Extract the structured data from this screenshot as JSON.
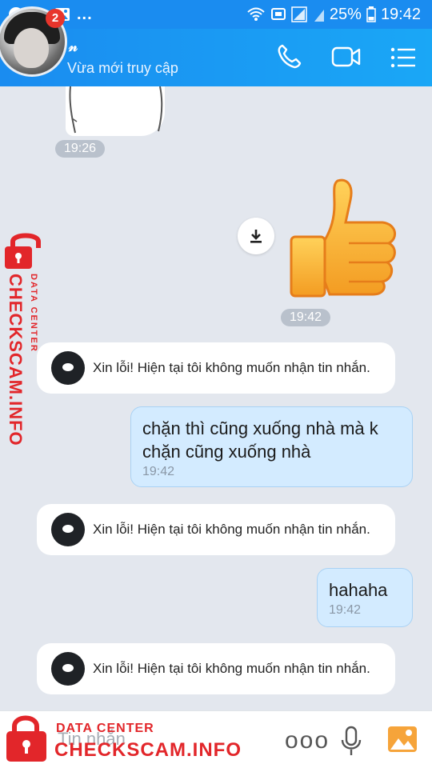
{
  "status_bar": {
    "notification_icons": [
      "messenger-icon",
      "person-add-icon",
      "image-icon"
    ],
    "more_indicator": "...",
    "battery_percent": "25%",
    "time": "19:42"
  },
  "header": {
    "badge_count": "2",
    "contact_name": "𝓃",
    "contact_status": "Vừa mới truy cập",
    "actions": [
      "phone-icon",
      "video-call-icon",
      "menu-icon"
    ]
  },
  "messages": [
    {
      "type": "sticker",
      "sender": "contact",
      "time": "19:26"
    },
    {
      "type": "sticker",
      "sender": "me",
      "sticker": "thumbs-up",
      "time": "19:42"
    },
    {
      "type": "system",
      "text": "Xin lỗi! Hiện tại tôi không muốn nhận tin nhắn."
    },
    {
      "type": "text",
      "sender": "me",
      "line1": "chặn thì cũng xuống nhà mà k",
      "line2": "chặn cũng xuống nhà",
      "time": "19:42"
    },
    {
      "type": "system",
      "text": "Xin lỗi! Hiện tại tôi không muốn nhận tin nhắn."
    },
    {
      "type": "text",
      "sender": "me",
      "text": "hahaha",
      "time": "19:42"
    },
    {
      "type": "system",
      "text": "Xin lỗi! Hiện tại tôi không muốn nhận tin nhắn."
    }
  ],
  "watermark": {
    "side_big": "CHECKSCAM.INFO",
    "side_small": "DATA CENTER",
    "bottom_small": "DATA CENTER",
    "bottom_big": "CHECKSCAM.INFO"
  },
  "input": {
    "placeholder": "Tin nhắn"
  },
  "bottom_actions": {
    "more_label": "ooo",
    "icons": [
      "microphone-icon",
      "gallery-icon"
    ]
  },
  "colors": {
    "header_blue": "#1a8cf0",
    "bubble_blue": "#d3ebff",
    "watermark_red": "#e2262a",
    "chat_background": "#e3e7ee"
  }
}
